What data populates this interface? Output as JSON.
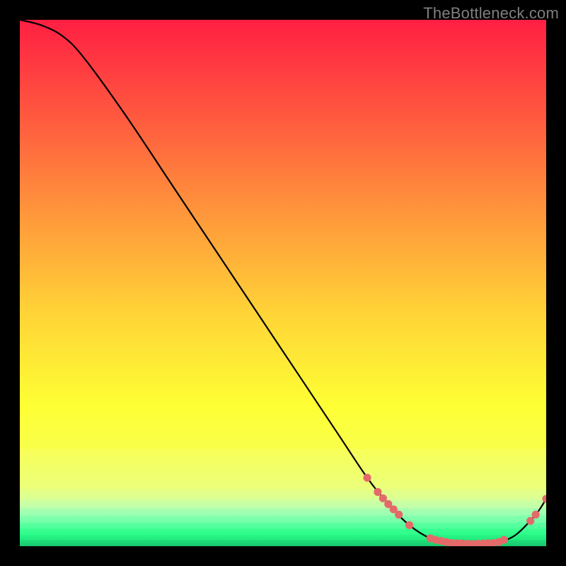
{
  "watermark": "TheBottleneck.com",
  "chart_data": {
    "type": "line",
    "title": "",
    "xlabel": "",
    "ylabel": "",
    "xlim": [
      0,
      100
    ],
    "ylim": [
      0,
      100
    ],
    "series": [
      {
        "name": "curve",
        "x": [
          0,
          4,
          8,
          12,
          20,
          30,
          40,
          50,
          60,
          66,
          70,
          74,
          78,
          82,
          86,
          90,
          94,
          98,
          100
        ],
        "y": [
          100,
          99,
          97,
          93,
          82,
          67,
          52,
          37,
          22,
          13,
          8,
          4,
          1.5,
          0.6,
          0.4,
          0.6,
          2.0,
          6.0,
          9.0
        ]
      }
    ],
    "markers": [
      {
        "x": 66,
        "y": 13.0
      },
      {
        "x": 68,
        "y": 10.3
      },
      {
        "x": 69,
        "y": 9.1
      },
      {
        "x": 70,
        "y": 8.0
      },
      {
        "x": 71,
        "y": 7.0
      },
      {
        "x": 72,
        "y": 6.0
      },
      {
        "x": 74,
        "y": 4.0
      },
      {
        "x": 78,
        "y": 1.5
      },
      {
        "x": 79,
        "y": 1.2
      },
      {
        "x": 80,
        "y": 1.0
      },
      {
        "x": 81,
        "y": 0.8
      },
      {
        "x": 82,
        "y": 0.6
      },
      {
        "x": 83,
        "y": 0.55
      },
      {
        "x": 84,
        "y": 0.5
      },
      {
        "x": 85,
        "y": 0.45
      },
      {
        "x": 86,
        "y": 0.4
      },
      {
        "x": 87,
        "y": 0.45
      },
      {
        "x": 88,
        "y": 0.5
      },
      {
        "x": 89,
        "y": 0.55
      },
      {
        "x": 90,
        "y": 0.6
      },
      {
        "x": 91,
        "y": 0.8
      },
      {
        "x": 92,
        "y": 1.2
      },
      {
        "x": 97,
        "y": 4.8
      },
      {
        "x": 98,
        "y": 6.0
      },
      {
        "x": 100,
        "y": 9.0
      }
    ],
    "gradient_bands": [
      {
        "y0": 100,
        "y1": 18.5,
        "stops": [
          {
            "at": 0.0,
            "c": "#ff1f43"
          },
          {
            "at": 0.23,
            "c": "#ff5a3f"
          },
          {
            "at": 0.45,
            "c": "#ff963b"
          },
          {
            "at": 0.68,
            "c": "#ffd337"
          },
          {
            "at": 0.9,
            "c": "#feff34"
          },
          {
            "at": 1.0,
            "c": "#f8ff4a"
          }
        ]
      },
      {
        "y0": 18.5,
        "y1": 10.8,
        "stops": [
          {
            "at": 0.0,
            "c": "#f8ff57"
          },
          {
            "at": 1.0,
            "c": "#eaff7c"
          }
        ]
      },
      {
        "y0": 10.8,
        "y1": 8.8,
        "stops": [
          {
            "at": 0.0,
            "c": "#e6ff84"
          },
          {
            "at": 1.0,
            "c": "#d8ff96"
          }
        ]
      },
      {
        "y0": 8.8,
        "y1": 7.2,
        "stops": [
          {
            "at": 0.0,
            "c": "#cfffa1"
          },
          {
            "at": 1.0,
            "c": "#beffab"
          }
        ]
      },
      {
        "y0": 7.2,
        "y1": 5.8,
        "stops": [
          {
            "at": 0.0,
            "c": "#abffb0"
          },
          {
            "at": 1.0,
            "c": "#97ffb0"
          }
        ]
      },
      {
        "y0": 5.8,
        "y1": 4.5,
        "stops": [
          {
            "at": 0.0,
            "c": "#86ffae"
          },
          {
            "at": 1.0,
            "c": "#70ffa8"
          }
        ]
      },
      {
        "y0": 4.5,
        "y1": 3.3,
        "stops": [
          {
            "at": 0.0,
            "c": "#5effa1"
          },
          {
            "at": 1.0,
            "c": "#4aff99"
          }
        ]
      },
      {
        "y0": 3.3,
        "y1": 2.2,
        "stops": [
          {
            "at": 0.0,
            "c": "#3cff92"
          },
          {
            "at": 1.0,
            "c": "#2dfb8a"
          }
        ]
      },
      {
        "y0": 2.2,
        "y1": 1.2,
        "stops": [
          {
            "at": 0.0,
            "c": "#28f786"
          },
          {
            "at": 1.0,
            "c": "#21e97d"
          }
        ]
      },
      {
        "y0": 1.2,
        "y1": 0.0,
        "stops": [
          {
            "at": 0.0,
            "c": "#1fe07a"
          },
          {
            "at": 1.0,
            "c": "#18c56d"
          }
        ]
      }
    ],
    "marker_color": "#e46a6a",
    "line_color": "#000000"
  }
}
